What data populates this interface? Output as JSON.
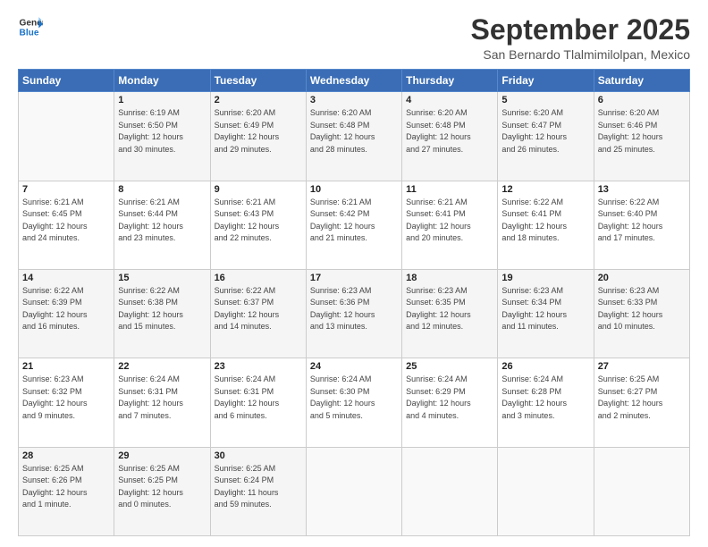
{
  "header": {
    "logo_line1": "General",
    "logo_line2": "Blue",
    "month": "September 2025",
    "location": "San Bernardo Tlalmimilolpan, Mexico"
  },
  "weekdays": [
    "Sunday",
    "Monday",
    "Tuesday",
    "Wednesday",
    "Thursday",
    "Friday",
    "Saturday"
  ],
  "rows": [
    [
      {
        "day": "",
        "info": ""
      },
      {
        "day": "1",
        "info": "Sunrise: 6:19 AM\nSunset: 6:50 PM\nDaylight: 12 hours\nand 30 minutes."
      },
      {
        "day": "2",
        "info": "Sunrise: 6:20 AM\nSunset: 6:49 PM\nDaylight: 12 hours\nand 29 minutes."
      },
      {
        "day": "3",
        "info": "Sunrise: 6:20 AM\nSunset: 6:48 PM\nDaylight: 12 hours\nand 28 minutes."
      },
      {
        "day": "4",
        "info": "Sunrise: 6:20 AM\nSunset: 6:48 PM\nDaylight: 12 hours\nand 27 minutes."
      },
      {
        "day": "5",
        "info": "Sunrise: 6:20 AM\nSunset: 6:47 PM\nDaylight: 12 hours\nand 26 minutes."
      },
      {
        "day": "6",
        "info": "Sunrise: 6:20 AM\nSunset: 6:46 PM\nDaylight: 12 hours\nand 25 minutes."
      }
    ],
    [
      {
        "day": "7",
        "info": "Sunrise: 6:21 AM\nSunset: 6:45 PM\nDaylight: 12 hours\nand 24 minutes."
      },
      {
        "day": "8",
        "info": "Sunrise: 6:21 AM\nSunset: 6:44 PM\nDaylight: 12 hours\nand 23 minutes."
      },
      {
        "day": "9",
        "info": "Sunrise: 6:21 AM\nSunset: 6:43 PM\nDaylight: 12 hours\nand 22 minutes."
      },
      {
        "day": "10",
        "info": "Sunrise: 6:21 AM\nSunset: 6:42 PM\nDaylight: 12 hours\nand 21 minutes."
      },
      {
        "day": "11",
        "info": "Sunrise: 6:21 AM\nSunset: 6:41 PM\nDaylight: 12 hours\nand 20 minutes."
      },
      {
        "day": "12",
        "info": "Sunrise: 6:22 AM\nSunset: 6:41 PM\nDaylight: 12 hours\nand 18 minutes."
      },
      {
        "day": "13",
        "info": "Sunrise: 6:22 AM\nSunset: 6:40 PM\nDaylight: 12 hours\nand 17 minutes."
      }
    ],
    [
      {
        "day": "14",
        "info": "Sunrise: 6:22 AM\nSunset: 6:39 PM\nDaylight: 12 hours\nand 16 minutes."
      },
      {
        "day": "15",
        "info": "Sunrise: 6:22 AM\nSunset: 6:38 PM\nDaylight: 12 hours\nand 15 minutes."
      },
      {
        "day": "16",
        "info": "Sunrise: 6:22 AM\nSunset: 6:37 PM\nDaylight: 12 hours\nand 14 minutes."
      },
      {
        "day": "17",
        "info": "Sunrise: 6:23 AM\nSunset: 6:36 PM\nDaylight: 12 hours\nand 13 minutes."
      },
      {
        "day": "18",
        "info": "Sunrise: 6:23 AM\nSunset: 6:35 PM\nDaylight: 12 hours\nand 12 minutes."
      },
      {
        "day": "19",
        "info": "Sunrise: 6:23 AM\nSunset: 6:34 PM\nDaylight: 12 hours\nand 11 minutes."
      },
      {
        "day": "20",
        "info": "Sunrise: 6:23 AM\nSunset: 6:33 PM\nDaylight: 12 hours\nand 10 minutes."
      }
    ],
    [
      {
        "day": "21",
        "info": "Sunrise: 6:23 AM\nSunset: 6:32 PM\nDaylight: 12 hours\nand 9 minutes."
      },
      {
        "day": "22",
        "info": "Sunrise: 6:24 AM\nSunset: 6:31 PM\nDaylight: 12 hours\nand 7 minutes."
      },
      {
        "day": "23",
        "info": "Sunrise: 6:24 AM\nSunset: 6:31 PM\nDaylight: 12 hours\nand 6 minutes."
      },
      {
        "day": "24",
        "info": "Sunrise: 6:24 AM\nSunset: 6:30 PM\nDaylight: 12 hours\nand 5 minutes."
      },
      {
        "day": "25",
        "info": "Sunrise: 6:24 AM\nSunset: 6:29 PM\nDaylight: 12 hours\nand 4 minutes."
      },
      {
        "day": "26",
        "info": "Sunrise: 6:24 AM\nSunset: 6:28 PM\nDaylight: 12 hours\nand 3 minutes."
      },
      {
        "day": "27",
        "info": "Sunrise: 6:25 AM\nSunset: 6:27 PM\nDaylight: 12 hours\nand 2 minutes."
      }
    ],
    [
      {
        "day": "28",
        "info": "Sunrise: 6:25 AM\nSunset: 6:26 PM\nDaylight: 12 hours\nand 1 minute."
      },
      {
        "day": "29",
        "info": "Sunrise: 6:25 AM\nSunset: 6:25 PM\nDaylight: 12 hours\nand 0 minutes."
      },
      {
        "day": "30",
        "info": "Sunrise: 6:25 AM\nSunset: 6:24 PM\nDaylight: 11 hours\nand 59 minutes."
      },
      {
        "day": "",
        "info": ""
      },
      {
        "day": "",
        "info": ""
      },
      {
        "day": "",
        "info": ""
      },
      {
        "day": "",
        "info": ""
      }
    ]
  ]
}
